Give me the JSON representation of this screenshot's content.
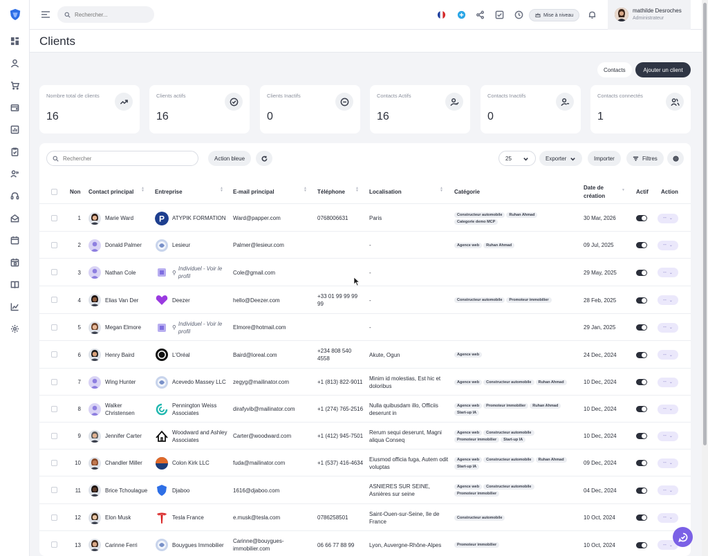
{
  "topbar": {
    "search_placeholder": "Rechercher...",
    "upgrade_label": "Mise à niveau",
    "user_name": "mathilde Desroches",
    "user_role": "Administrateur"
  },
  "page": {
    "title": "Clients",
    "contacts_button": "Contacts",
    "add_client_button": "Ajouter un client"
  },
  "stats": [
    {
      "label": "Nombre total de clients",
      "value": "16",
      "icon": "trending-up-icon"
    },
    {
      "label": "Clients actifs",
      "value": "16",
      "icon": "check-circle-icon"
    },
    {
      "label": "Clients Inactifs",
      "value": "0",
      "icon": "minus-circle-icon"
    },
    {
      "label": "Contacts Actifs",
      "value": "16",
      "icon": "user-check-icon"
    },
    {
      "label": "Contacts Inactifs",
      "value": "0",
      "icon": "user-minus-icon"
    },
    {
      "label": "Contacts connectés",
      "value": "1",
      "icon": "users-icon"
    }
  ],
  "toolbar": {
    "search_placeholder": "Rechercher",
    "action_bleue": "Action bleue",
    "page_size": "25",
    "export": "Exporter",
    "import": "Importer",
    "filters": "Filtres"
  },
  "columns": {
    "num": "Non",
    "contact": "Contact principal",
    "company": "Entreprise",
    "email": "E-mail principal",
    "phone": "Téléphone",
    "location": "Localisation",
    "category": "Catégorie",
    "date": "Date de création",
    "active": "Actif",
    "action": "Action"
  },
  "action_label": "--",
  "rows": [
    {
      "num": "1",
      "contact": "Marie Ward",
      "company": "ATYPIK FORMATION",
      "email": "Ward@papper.com",
      "phone": "0768006631",
      "location": "Paris",
      "tags": [
        "Constructeur automobile",
        "Ruhan Ahmad",
        "Categorie demo MCP"
      ],
      "date": "30 Mar, 2026"
    },
    {
      "num": "2",
      "contact": "Donald Palmer",
      "company": "Lesieur",
      "email": "Palmer@lesieur.com",
      "phone": "",
      "location": "-",
      "tags": [
        "Agence web",
        "Ruhan Ahmad"
      ],
      "date": "09 Jul, 2025"
    },
    {
      "num": "3",
      "contact": "Nathan Cole",
      "company": "Individuel - Voir le profil",
      "email": "Cole@gmail.com",
      "phone": "",
      "location": "-",
      "tags": [],
      "date": "29 May, 2025"
    },
    {
      "num": "4",
      "contact": "Elias Van Der",
      "company": "Deezer",
      "email": "hello@Deezer.com",
      "phone": "+33 01 99 99 99 99",
      "location": "-",
      "tags": [
        "Constructeur automobile",
        "Promoteur immobilier"
      ],
      "date": "28 Feb, 2025"
    },
    {
      "num": "5",
      "contact": "Megan Elmore",
      "company": "Individuel - Voir le profil",
      "email": "Elmore@hotmail.com",
      "phone": "",
      "location": "-",
      "tags": [],
      "date": "29 Jan, 2025"
    },
    {
      "num": "6",
      "contact": "Henry Baird",
      "company": "L'Oréal",
      "email": "Baird@loreal.com",
      "phone": "+234 808 540 4558",
      "location": "Akute, Ogun",
      "tags": [
        "Agence web"
      ],
      "date": "24 Dec, 2024"
    },
    {
      "num": "7",
      "contact": "Wing Hunter",
      "company": "Acevedo Massey LLC",
      "email": "zegyg@mailinator.com",
      "phone": "+1 (813) 822-9011",
      "location": "Minim id molestias, Est hic et doloribus",
      "tags": [
        "Agence web",
        "Constructeur automobile",
        "Ruhan Ahmad"
      ],
      "date": "10 Dec, 2024"
    },
    {
      "num": "8",
      "contact": "Walker Christensen",
      "company": "Pennington Weiss Associates",
      "email": "dirafyvib@mailinator.com",
      "phone": "+1 (274) 765-2516",
      "location": "Nulla quibusdam illo, Officiis deserunt in",
      "tags": [
        "Agence web",
        "Promoteur immobilier",
        "Ruhan Ahmad",
        "Start-up IA"
      ],
      "date": "10 Dec, 2024"
    },
    {
      "num": "9",
      "contact": "Jennifer Carter",
      "company": "Woodward and Ashley Associates",
      "email": "Carter@woodward.com",
      "phone": "+1 (412) 945-7501",
      "location": "Rerum sequi deserunt, Magni aliqua Conseq",
      "tags": [
        "Agence web",
        "Constructeur automobile",
        "Promoteur immobilier",
        "Start-up IA"
      ],
      "date": "10 Dec, 2024"
    },
    {
      "num": "10",
      "contact": "Chandler Miller",
      "company": "Colon Kirk LLC",
      "email": "fuda@mailinator.com",
      "phone": "+1 (537) 416-4634",
      "location": "Eiusmod officia fuga, Autem odit voluptas",
      "tags": [
        "Agence web",
        "Constructeur automobile",
        "Ruhan Ahmad",
        "Start-up IA"
      ],
      "date": "09 Dec, 2024"
    },
    {
      "num": "11",
      "contact": "Brice Tchoulague",
      "company": "Djaboo",
      "email": "1616@djaboo.com",
      "phone": "",
      "location": "ASNIERES SUR SEINE, Asnières sur seine",
      "tags": [
        "Agence web",
        "Constructeur automobile",
        "Promoteur immobilier"
      ],
      "date": "04 Dec, 2024"
    },
    {
      "num": "12",
      "contact": "Elon Musk",
      "company": "Tesla France",
      "email": "e.musk@tesla.com",
      "phone": "0786258501",
      "location": "Saint-Ouen-sur-Seine, Ile de France",
      "tags": [
        "Constructeur automobile"
      ],
      "date": "10 Oct, 2024"
    },
    {
      "num": "13",
      "contact": "Carinne Ferri",
      "company": "Bouygues Immobilier",
      "email": "Carinne@bouygues-immobilier.com",
      "phone": "06 66 77 88 99",
      "location": "Lyon, Auvergne-Rhône-Alpes",
      "tags": [
        "Promoteur immobilier"
      ],
      "date": "10 Oct, 2024"
    }
  ]
}
